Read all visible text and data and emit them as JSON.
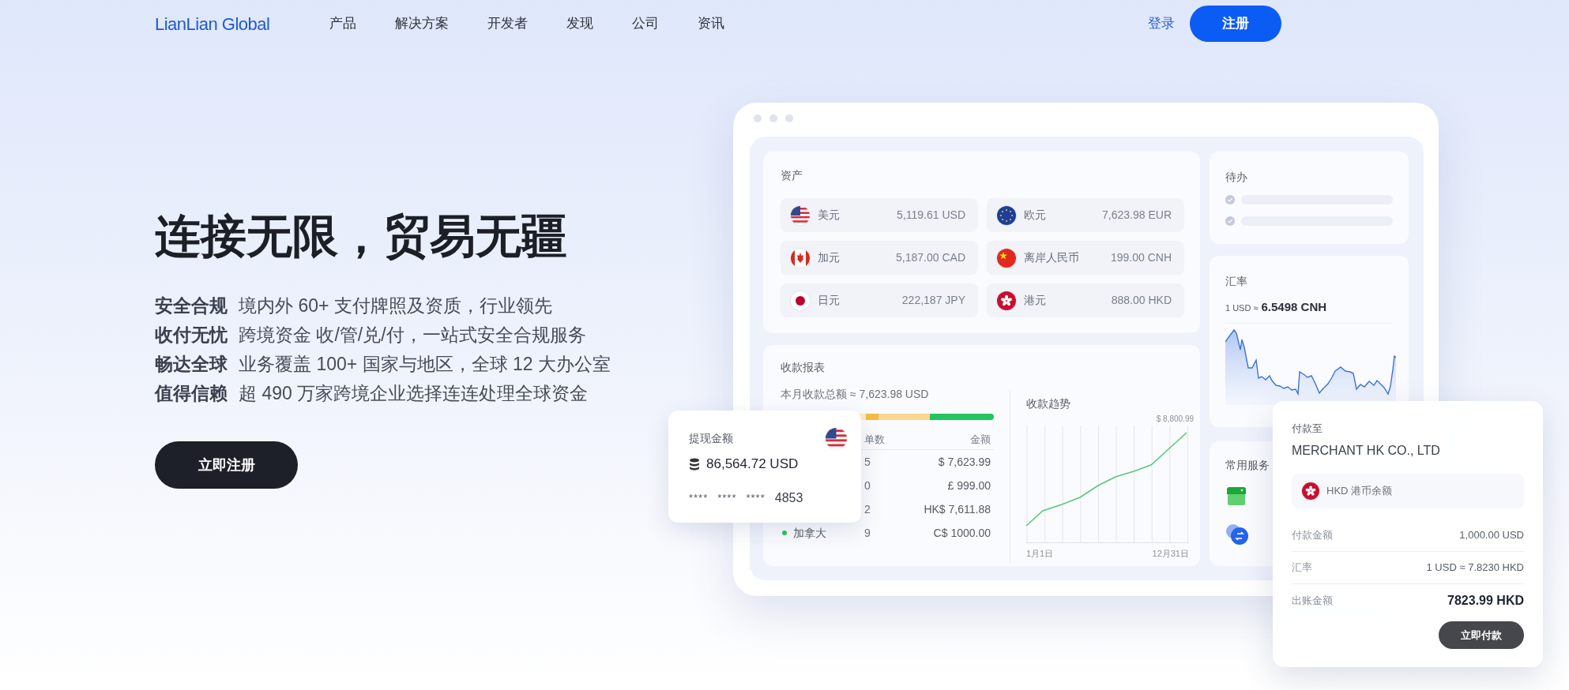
{
  "nav": {
    "logo": "LianLian Global",
    "links": [
      "产品",
      "解决方案",
      "开发者",
      "发现",
      "公司",
      "资讯"
    ],
    "login": "登录",
    "signup": "注册"
  },
  "hero": {
    "title": "连接无限，贸易无疆",
    "features": [
      {
        "label": "安全合规",
        "text": "境内外 60+ 支付牌照及资质，行业领先"
      },
      {
        "label": "收付无忧",
        "text": "跨境资金 收/管/兑/付，一站式安全合规服务"
      },
      {
        "label": "畅达全球",
        "text": "业务覆盖 100+ 国家与地区，全球 12 大办公室"
      },
      {
        "label": "值得信赖",
        "text": "超 490 万家跨境企业选择连连处理全球资金"
      }
    ],
    "cta": "立即注册"
  },
  "dashboard": {
    "assets": {
      "title": "资产",
      "items": [
        {
          "kind": "us",
          "name": "美元",
          "amount": "5,119.61 USD"
        },
        {
          "kind": "eu",
          "name": "欧元",
          "amount": "7,623.98 EUR"
        },
        {
          "kind": "ca",
          "name": "加元",
          "amount": "5,187.00 CAD"
        },
        {
          "kind": "cn",
          "name": "离岸人民币",
          "amount": "199.00 CNH"
        },
        {
          "kind": "jp",
          "name": "日元",
          "amount": "222,187 JPY"
        },
        {
          "kind": "hk",
          "name": "港元",
          "amount": "888.00 HKD"
        }
      ]
    },
    "report": {
      "title": "收款报表",
      "summary": "本月收款总额 ≈ 7,623.98 USD",
      "share_bar": [
        {
          "color": "#fdebc0"
        },
        {
          "color": "#f6bb42"
        },
        {
          "color": "#f9d88f"
        },
        {
          "color": "#22c55e"
        }
      ],
      "columns": [
        "单数",
        "金额"
      ],
      "rows": [
        {
          "count": "5",
          "amount": "$ 7,623.99"
        },
        {
          "count": "0",
          "amount": "£ 999.00"
        },
        {
          "count": "2",
          "amount": "HK$ 7,611.88"
        },
        {
          "region": "加拿大",
          "color": "#22c55e",
          "count": "9",
          "amount": "C$ 1000.00"
        }
      ]
    },
    "trend": {
      "title": "收款趋势",
      "peak": "$ 8,800.99",
      "start": "1月1日",
      "end": "12月31日"
    },
    "todo": {
      "title": "待办",
      "items": [
        {
          "kind": "skeleton"
        },
        {
          "kind": "skeleton"
        }
      ]
    },
    "rate": {
      "title": "汇率",
      "base": "1 USD ≈",
      "value": "6.5498 CNH"
    },
    "services": {
      "title": "常用服务",
      "items": [
        {
          "kind": "store"
        },
        {
          "kind": "exchange"
        }
      ]
    }
  },
  "withdraw": {
    "title": "提现金额",
    "amount": "86,564.72 USD",
    "card_groups": [
      "****",
      "****",
      "****"
    ],
    "card_last": "4853"
  },
  "payment": {
    "title": "付款至",
    "payee": "MERCHANT HK CO., LTD",
    "source": {
      "kind": "hk",
      "label": "HKD 港币余额"
    },
    "rows": [
      {
        "label": "付款金额",
        "value": "1,000.00 USD",
        "emphasis": false
      },
      {
        "label": "汇率",
        "value": "1 USD ≈ 7.8230 HKD",
        "emphasis": false
      },
      {
        "label": "出账金额",
        "value": "7823.99 HKD",
        "emphasis": true
      }
    ],
    "button": "立即付款"
  }
}
